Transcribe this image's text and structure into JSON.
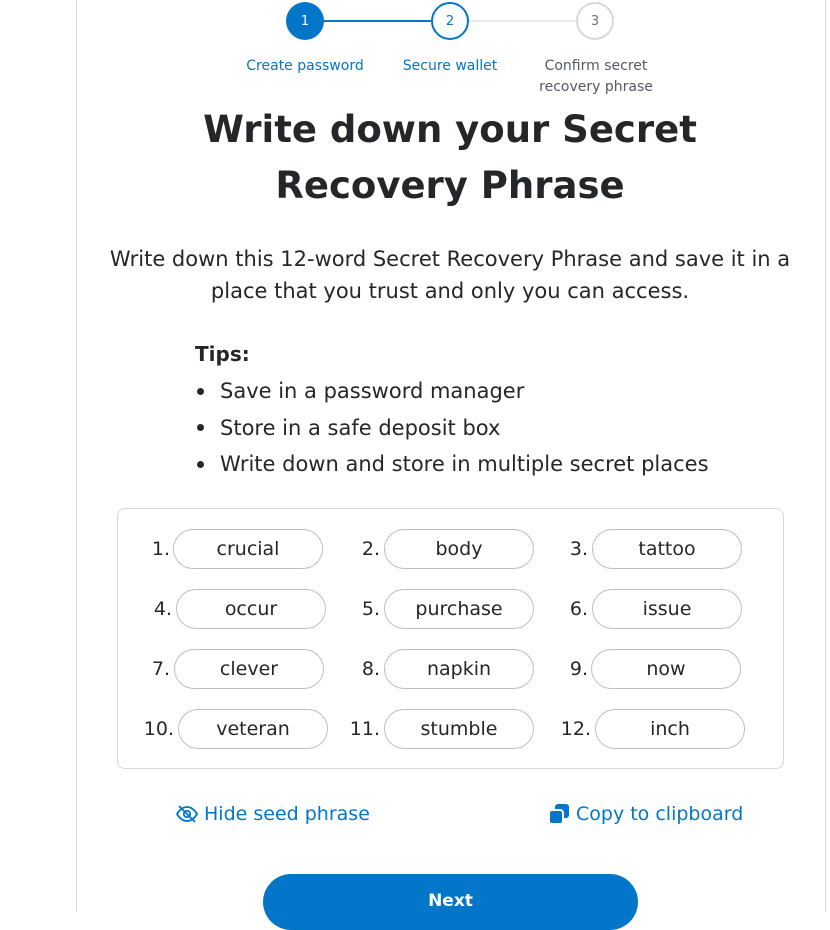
{
  "colors": {
    "accent": "#0376c9",
    "text": "#24272a",
    "muted": "#6a737d",
    "border": "#d6d9dc"
  },
  "stepper": {
    "steps": [
      {
        "number": "1",
        "label": "Create password",
        "state": "completed"
      },
      {
        "number": "2",
        "label": "Secure wallet",
        "state": "active"
      },
      {
        "number": "3",
        "label": "Confirm secret recovery phrase",
        "state": "pending"
      }
    ]
  },
  "title_line1": "Write down your Secret",
  "title_line2": "Recovery Phrase",
  "description": "Write down this 12-word Secret Recovery Phrase and save it in a place that you trust and only you can access.",
  "tips": {
    "heading": "Tips:",
    "items": [
      "Save in a password manager",
      "Store in a safe deposit box",
      "Write down and store in multiple secret places"
    ]
  },
  "phrase": {
    "words": [
      {
        "n": "1.",
        "w": "crucial"
      },
      {
        "n": "2.",
        "w": "body"
      },
      {
        "n": "3.",
        "w": "tattoo"
      },
      {
        "n": "4.",
        "w": "occur"
      },
      {
        "n": "5.",
        "w": "purchase"
      },
      {
        "n": "6.",
        "w": "issue"
      },
      {
        "n": "7.",
        "w": "clever"
      },
      {
        "n": "8.",
        "w": "napkin"
      },
      {
        "n": "9.",
        "w": "now"
      },
      {
        "n": "10.",
        "w": "veteran"
      },
      {
        "n": "11.",
        "w": "stumble"
      },
      {
        "n": "12.",
        "w": "inch"
      }
    ]
  },
  "actions": {
    "hide_label": "Hide seed phrase",
    "hide_icon": "eye-slash-icon",
    "copy_label": "Copy to clipboard",
    "copy_icon": "copy-icon"
  },
  "next_label": "Next"
}
